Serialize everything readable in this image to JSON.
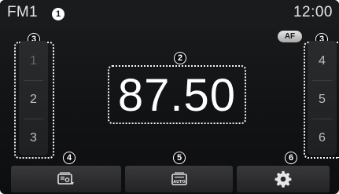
{
  "status_bar": {
    "band": "FM1",
    "clock": "12:00"
  },
  "frequency": {
    "value": "87.50"
  },
  "af_badge": "AF",
  "presets": {
    "left": [
      "1",
      "2",
      "3"
    ],
    "right": [
      "4",
      "5",
      "6"
    ]
  },
  "callouts": [
    "1",
    "2",
    "3",
    "3",
    "4",
    "5",
    "6"
  ],
  "bottom_buttons": [
    {
      "icon": "radio-info-icon"
    },
    {
      "icon": "auto-store-icon",
      "label": "AUTO"
    },
    {
      "icon": "gear-icon"
    }
  ],
  "colors": {
    "background": "#121314",
    "text": "#ffffff",
    "preset_text": "#bfbfbf",
    "callout_border": "#f5f5f5"
  }
}
